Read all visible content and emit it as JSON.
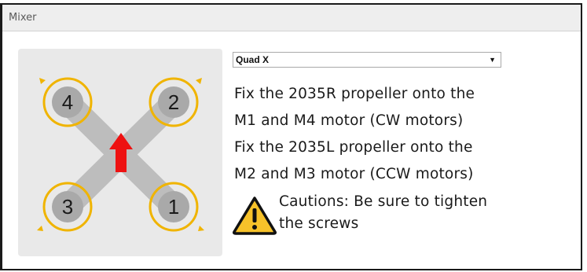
{
  "panel": {
    "title": "Mixer"
  },
  "mixer": {
    "selected": "Quad X",
    "arrow_icon": "dropdown-arrow-icon",
    "motors": [
      {
        "label": "4",
        "position": "top-left"
      },
      {
        "label": "2",
        "position": "top-right"
      },
      {
        "label": "3",
        "position": "bottom-left"
      },
      {
        "label": "1",
        "position": "bottom-right"
      }
    ],
    "colors": {
      "frame": "#bdbdbd",
      "prop_ring": "#f0b400",
      "direction_arrow": "#ee1111",
      "background": "#e9e9e9"
    }
  },
  "instructions": {
    "line1": "Fix the 2035R propeller onto the",
    "line2": "M1 and M4 motor (CW motors)",
    "line3": "Fix the 2035L propeller onto the",
    "line4": "M2 and M3 motor (CCW motors)"
  },
  "caution": {
    "icon": "warning-icon",
    "line1": "Cautions: Be sure to tighten",
    "line2": "the screws"
  }
}
